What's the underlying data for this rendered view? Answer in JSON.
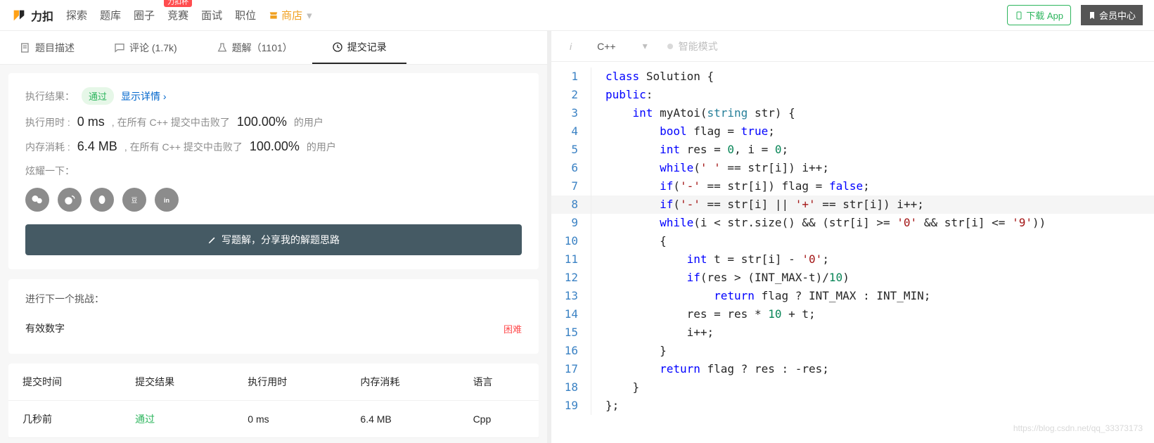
{
  "nav": {
    "brand": "力扣",
    "items": [
      "探索",
      "题库",
      "圈子",
      "竞赛",
      "面试",
      "职位"
    ],
    "cup_badge": "力扣杯",
    "store": "商店",
    "download": "下载 App",
    "member": "会员中心"
  },
  "tabs": {
    "desc": "题目描述",
    "comments": "评论 (1.7k)",
    "solutions": "题解（1101）",
    "submissions": "提交记录"
  },
  "result": {
    "exec_label": "执行结果：",
    "pass_pill": "通过",
    "detail_link": "显示详情",
    "time_label": "执行用时 :",
    "time_val": "0 ms",
    "time_mid": ", 在所有 C++ 提交中击败了",
    "time_pct": "100.00%",
    "time_suf": "的用户",
    "mem_label": "内存消耗 :",
    "mem_val": "6.4 MB",
    "mem_mid": ", 在所有 C++ 提交中击败了",
    "mem_pct": "100.00%",
    "mem_suf": "的用户",
    "share_label": "炫耀一下：",
    "write_btn": "写题解，分享我的解题思路"
  },
  "challenge": {
    "title": "进行下一个挑战：",
    "item": "有效数字",
    "diff": "困难"
  },
  "history": {
    "h_time": "提交时间",
    "h_result": "提交结果",
    "h_exec": "执行用时",
    "h_mem": "内存消耗",
    "h_lang": "语言",
    "r_time": "几秒前",
    "r_result": "通过",
    "r_exec": "0 ms",
    "r_mem": "6.4 MB",
    "r_lang": "Cpp"
  },
  "editor": {
    "lang": "C++",
    "smart": "智能模式",
    "hl_line": 8,
    "lines": [
      [
        [
          "kw",
          "class"
        ],
        [
          "op",
          " "
        ],
        [
          "ident",
          "Solution"
        ],
        [
          "op",
          " {"
        ]
      ],
      [
        [
          "kw",
          "public"
        ],
        [
          "op",
          ":"
        ]
      ],
      [
        [
          "op",
          "    "
        ],
        [
          "kw",
          "int"
        ],
        [
          "op",
          " "
        ],
        [
          "ident",
          "myAtoi"
        ],
        [
          "op",
          "("
        ],
        [
          "type",
          "string"
        ],
        [
          "op",
          " "
        ],
        [
          "ident",
          "str"
        ],
        [
          "op",
          ") {"
        ]
      ],
      [
        [
          "op",
          "        "
        ],
        [
          "kw",
          "bool"
        ],
        [
          "op",
          " "
        ],
        [
          "ident",
          "flag"
        ],
        [
          "op",
          " = "
        ],
        [
          "const",
          "true"
        ],
        [
          "op",
          ";"
        ]
      ],
      [
        [
          "op",
          "        "
        ],
        [
          "kw",
          "int"
        ],
        [
          "op",
          " "
        ],
        [
          "ident",
          "res"
        ],
        [
          "op",
          " = "
        ],
        [
          "num",
          "0"
        ],
        [
          "op",
          ", "
        ],
        [
          "ident",
          "i"
        ],
        [
          "op",
          " = "
        ],
        [
          "num",
          "0"
        ],
        [
          "op",
          ";"
        ]
      ],
      [
        [
          "op",
          "        "
        ],
        [
          "kw",
          "while"
        ],
        [
          "op",
          "("
        ],
        [
          "str",
          "' '"
        ],
        [
          "op",
          " == "
        ],
        [
          "ident",
          "str"
        ],
        [
          "op",
          "["
        ],
        [
          "ident",
          "i"
        ],
        [
          "op",
          "]) "
        ],
        [
          "ident",
          "i"
        ],
        [
          "op",
          "++;"
        ]
      ],
      [
        [
          "op",
          "        "
        ],
        [
          "kw",
          "if"
        ],
        [
          "op",
          "("
        ],
        [
          "str",
          "'-'"
        ],
        [
          "op",
          " == "
        ],
        [
          "ident",
          "str"
        ],
        [
          "op",
          "["
        ],
        [
          "ident",
          "i"
        ],
        [
          "op",
          "]) "
        ],
        [
          "ident",
          "flag"
        ],
        [
          "op",
          " = "
        ],
        [
          "const",
          "false"
        ],
        [
          "op",
          ";"
        ]
      ],
      [
        [
          "op",
          "        "
        ],
        [
          "kw",
          "if"
        ],
        [
          "op",
          "("
        ],
        [
          "str",
          "'-'"
        ],
        [
          "op",
          " == "
        ],
        [
          "ident",
          "str"
        ],
        [
          "op",
          "["
        ],
        [
          "ident",
          "i"
        ],
        [
          "op",
          "] || "
        ],
        [
          "str",
          "'+'"
        ],
        [
          "op",
          " == "
        ],
        [
          "ident",
          "str"
        ],
        [
          "op",
          "["
        ],
        [
          "ident",
          "i"
        ],
        [
          "op",
          "]) "
        ],
        [
          "ident",
          "i"
        ],
        [
          "op",
          "++;"
        ]
      ],
      [
        [
          "op",
          "        "
        ],
        [
          "kw",
          "while"
        ],
        [
          "op",
          "("
        ],
        [
          "ident",
          "i"
        ],
        [
          "op",
          " < "
        ],
        [
          "ident",
          "str"
        ],
        [
          "op",
          ".size() && ("
        ],
        [
          "ident",
          "str"
        ],
        [
          "op",
          "["
        ],
        [
          "ident",
          "i"
        ],
        [
          "op",
          "] >= "
        ],
        [
          "str",
          "'0'"
        ],
        [
          "op",
          " && "
        ],
        [
          "ident",
          "str"
        ],
        [
          "op",
          "["
        ],
        [
          "ident",
          "i"
        ],
        [
          "op",
          "] <= "
        ],
        [
          "str",
          "'9'"
        ],
        [
          "op",
          "))"
        ]
      ],
      [
        [
          "op",
          "        {"
        ]
      ],
      [
        [
          "op",
          "            "
        ],
        [
          "kw",
          "int"
        ],
        [
          "op",
          " "
        ],
        [
          "ident",
          "t"
        ],
        [
          "op",
          " = "
        ],
        [
          "ident",
          "str"
        ],
        [
          "op",
          "["
        ],
        [
          "ident",
          "i"
        ],
        [
          "op",
          "] - "
        ],
        [
          "str",
          "'0'"
        ],
        [
          "op",
          ";"
        ]
      ],
      [
        [
          "op",
          "            "
        ],
        [
          "kw",
          "if"
        ],
        [
          "op",
          "("
        ],
        [
          "ident",
          "res"
        ],
        [
          "op",
          " > ("
        ],
        [
          "ident",
          "INT_MAX"
        ],
        [
          "op",
          "-"
        ],
        [
          "ident",
          "t"
        ],
        [
          "op",
          ")/"
        ],
        [
          "num",
          "10"
        ],
        [
          "op",
          ")"
        ]
      ],
      [
        [
          "op",
          "                "
        ],
        [
          "kw",
          "return"
        ],
        [
          "op",
          " "
        ],
        [
          "ident",
          "flag"
        ],
        [
          "op",
          " ? "
        ],
        [
          "ident",
          "INT_MAX"
        ],
        [
          "op",
          " : "
        ],
        [
          "ident",
          "INT_MIN"
        ],
        [
          "op",
          ";"
        ]
      ],
      [
        [
          "op",
          "            "
        ],
        [
          "ident",
          "res"
        ],
        [
          "op",
          " = "
        ],
        [
          "ident",
          "res"
        ],
        [
          "op",
          " * "
        ],
        [
          "num",
          "10"
        ],
        [
          "op",
          " + "
        ],
        [
          "ident",
          "t"
        ],
        [
          "op",
          ";"
        ]
      ],
      [
        [
          "op",
          "            "
        ],
        [
          "ident",
          "i"
        ],
        [
          "op",
          "++;"
        ]
      ],
      [
        [
          "op",
          "        }"
        ]
      ],
      [
        [
          "op",
          "        "
        ],
        [
          "kw",
          "return"
        ],
        [
          "op",
          " "
        ],
        [
          "ident",
          "flag"
        ],
        [
          "op",
          " ? "
        ],
        [
          "ident",
          "res"
        ],
        [
          "op",
          " : -"
        ],
        [
          "ident",
          "res"
        ],
        [
          "op",
          ";"
        ]
      ],
      [
        [
          "op",
          "    }"
        ]
      ],
      [
        [
          "op",
          "};"
        ]
      ]
    ]
  },
  "watermark": "https://blog.csdn.net/qq_33373173"
}
